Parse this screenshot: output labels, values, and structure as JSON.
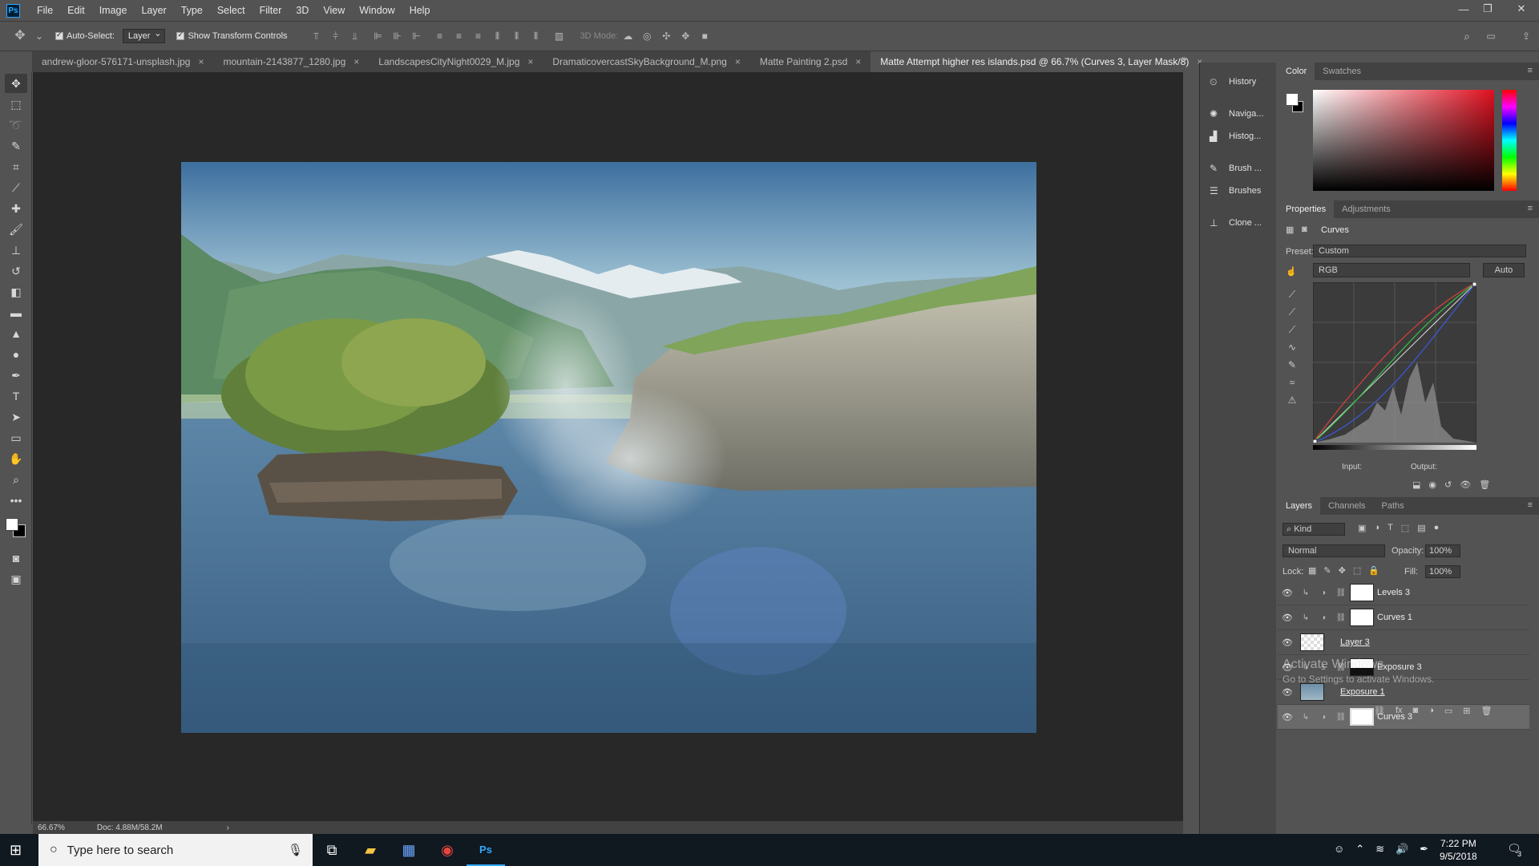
{
  "app": {
    "logo": "Ps"
  },
  "menu": [
    "File",
    "Edit",
    "Image",
    "Layer",
    "Type",
    "Select",
    "Filter",
    "3D",
    "View",
    "Window",
    "Help"
  ],
  "options": {
    "auto_select_label": "Auto-Select:",
    "auto_select_value": "Layer",
    "show_transform_label": "Show Transform Controls",
    "mode3d_label": "3D Mode:"
  },
  "tabs": [
    {
      "label": "andrew-gloor-576171-unsplash.jpg"
    },
    {
      "label": "mountain-2143877_1280.jpg"
    },
    {
      "label": "LandscapesCityNight0029_M.jpg"
    },
    {
      "label": "DramaticovercastSkyBackground_M.png"
    },
    {
      "label": "Matte Painting 2.psd"
    },
    {
      "label": "Matte Attempt higher res islands.psd @ 66.7% (Curves 3, Layer Mask/8)"
    }
  ],
  "status": {
    "zoom": "66.67%",
    "doc": "Doc: 4.88M/58.2M"
  },
  "dock": [
    "History",
    "Naviga...",
    "Histog...",
    "Brush ...",
    "Brushes",
    "Clone ..."
  ],
  "color_panel": {
    "tabs": [
      "Color",
      "Swatches"
    ]
  },
  "properties": {
    "tabs": [
      "Properties",
      "Adjustments"
    ],
    "title": "Curves",
    "preset_label": "Preset:",
    "preset_value": "Custom",
    "channel": "RGB",
    "auto_label": "Auto",
    "input_label": "Input:",
    "output_label": "Output:"
  },
  "layers_panel": {
    "tabs": [
      "Layers",
      "Channels",
      "Paths"
    ],
    "kind": "Kind",
    "blend": "Normal",
    "opacity_label": "Opacity:",
    "opacity": "100%",
    "lock_label": "Lock:",
    "fill_label": "Fill:",
    "fill": "100%",
    "layers": [
      {
        "name": "Levels 3",
        "kind": "adjustment"
      },
      {
        "name": "Curves 1",
        "kind": "adjustment"
      },
      {
        "name": "Layer 3",
        "kind": "pixel"
      },
      {
        "name": "Exposure 3",
        "kind": "adjustment"
      },
      {
        "name": "Exposure 1",
        "kind": "pixel"
      },
      {
        "name": "Curves 3",
        "kind": "adjustment"
      }
    ],
    "watermark_line1": "Activate Windows",
    "watermark_line2": "Go to Settings to activate Windows."
  },
  "taskbar": {
    "search_placeholder": "Type here to search",
    "time": "7:22 PM",
    "date": "9/5/2018",
    "notifications": "3"
  },
  "colors": {
    "accent": "#31a8ff",
    "canvas_bg": "#282828",
    "panel": "#535353"
  }
}
